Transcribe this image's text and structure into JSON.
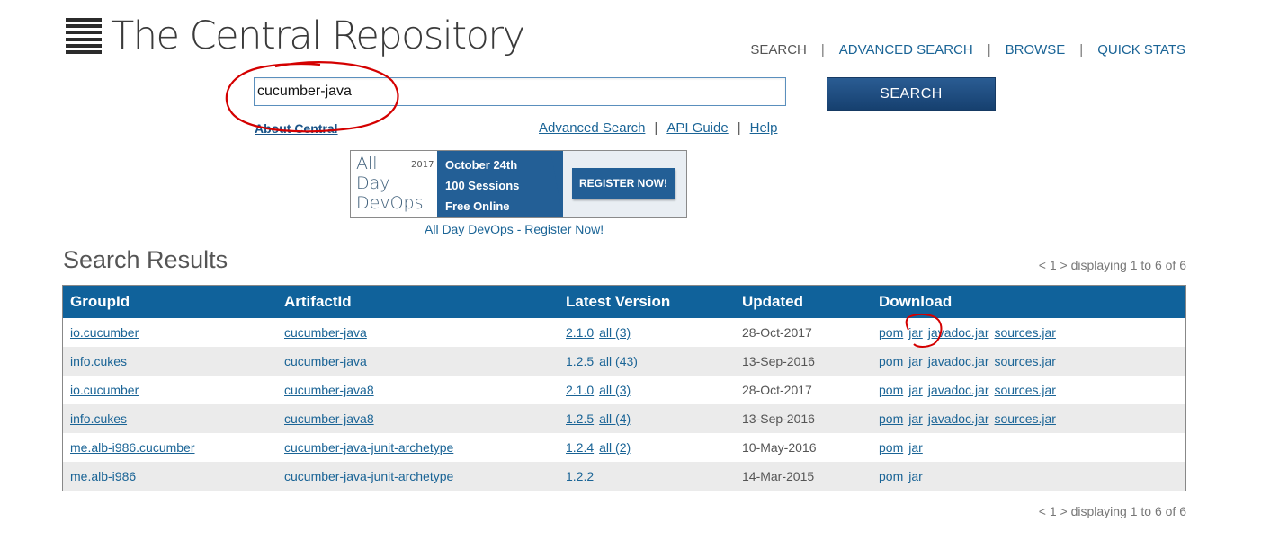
{
  "logo": {
    "text": "The Central Repository",
    "icon": "stacked-bars-icon"
  },
  "topnav": {
    "items": [
      "SEARCH",
      "ADVANCED SEARCH",
      "BROWSE",
      "QUICK STATS"
    ],
    "separator": "|"
  },
  "search": {
    "value": "cucumber-java",
    "button_label": "SEARCH"
  },
  "about_link": "About Central",
  "sublinks": [
    "Advanced Search",
    "API Guide",
    "Help"
  ],
  "banner": {
    "word1": "All",
    "word2": "Day",
    "word3": "DevOps",
    "year": "2017",
    "line1": "October 24th",
    "line2": "100 Sessions",
    "line3": "Free Online",
    "cta": "REGISTER NOW!",
    "caption": "All Day DevOps - Register Now!"
  },
  "results": {
    "title": "Search Results",
    "pager": "< 1 > displaying 1 to 6 of 6",
    "columns": [
      "GroupId",
      "ArtifactId",
      "Latest Version",
      "Updated",
      "Download"
    ],
    "rows": [
      {
        "group": "io.cucumber",
        "artifact": "cucumber-java",
        "version": "2.1.0",
        "all": "all (3)",
        "updated": "28-Oct-2017",
        "downloads": [
          "pom",
          "jar",
          "javadoc.jar",
          "sources.jar"
        ]
      },
      {
        "group": "info.cukes",
        "artifact": "cucumber-java",
        "version": "1.2.5",
        "all": "all (43)",
        "updated": "13-Sep-2016",
        "downloads": [
          "pom",
          "jar",
          "javadoc.jar",
          "sources.jar"
        ]
      },
      {
        "group": "io.cucumber",
        "artifact": "cucumber-java8",
        "version": "2.1.0",
        "all": "all (3)",
        "updated": "28-Oct-2017",
        "downloads": [
          "pom",
          "jar",
          "javadoc.jar",
          "sources.jar"
        ]
      },
      {
        "group": "info.cukes",
        "artifact": "cucumber-java8",
        "version": "1.2.5",
        "all": "all (4)",
        "updated": "13-Sep-2016",
        "downloads": [
          "pom",
          "jar",
          "javadoc.jar",
          "sources.jar"
        ]
      },
      {
        "group": "me.alb-i986.cucumber",
        "artifact": "cucumber-java-junit-archetype",
        "version": "1.2.4",
        "all": "all (2)",
        "updated": "10-May-2016",
        "downloads": [
          "pom",
          "jar"
        ]
      },
      {
        "group": "me.alb-i986",
        "artifact": "cucumber-java-junit-archetype",
        "version": "1.2.2",
        "all": "",
        "updated": "14-Mar-2015",
        "downloads": [
          "pom",
          "jar"
        ]
      }
    ]
  },
  "colors": {
    "header_blue": "#10629b",
    "link": "#1a6496",
    "button_navy": "#16406f",
    "annotation_red": "#d40000"
  }
}
